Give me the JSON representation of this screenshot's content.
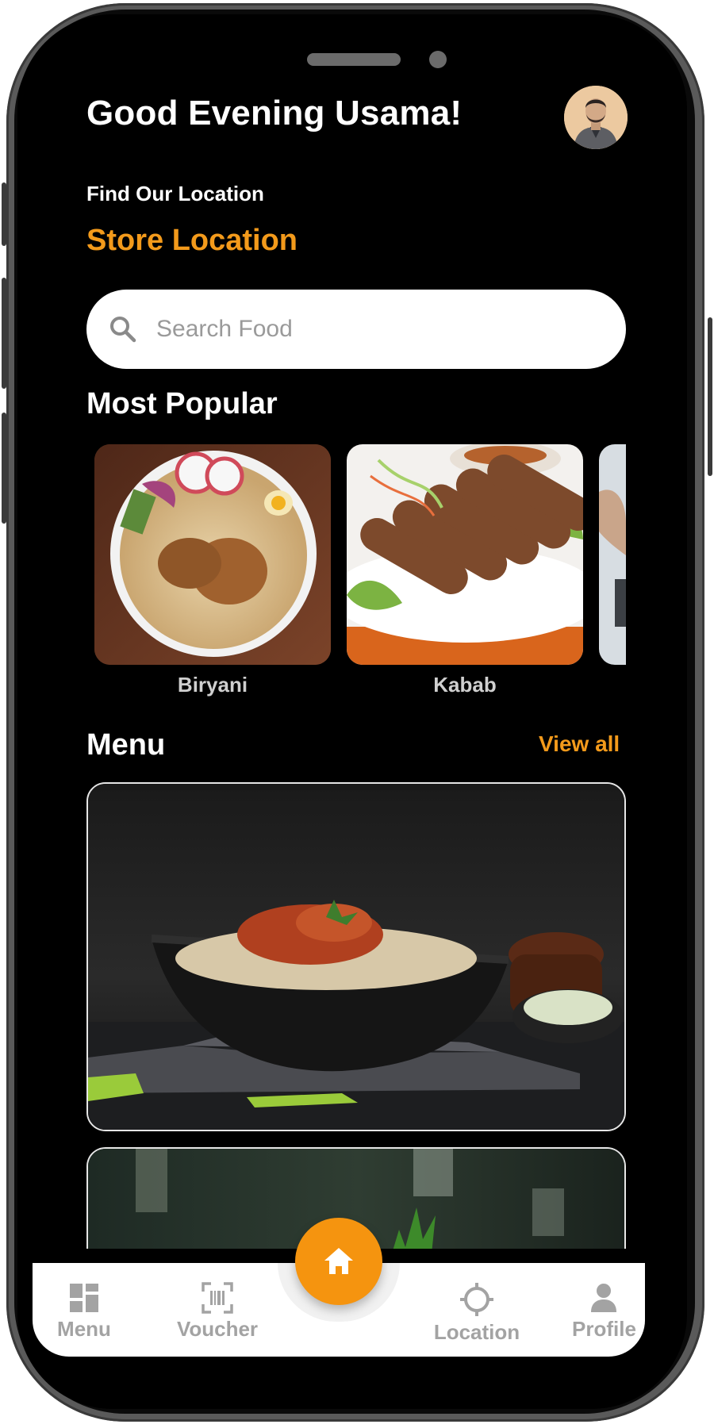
{
  "header": {
    "greeting": "Good Evening Usama!",
    "find_location": "Find Our Location",
    "store_location": "Store Location"
  },
  "search": {
    "placeholder": "Search Food"
  },
  "popular": {
    "title": "Most Popular",
    "items": [
      {
        "label": "Biryani"
      },
      {
        "label": "Kabab"
      }
    ]
  },
  "menu": {
    "title": "Menu",
    "view_all": "View all"
  },
  "bottom_nav": {
    "items": [
      {
        "label": "Menu",
        "icon": "grid-icon"
      },
      {
        "label": "Voucher",
        "icon": "barcode-scan-icon"
      },
      {
        "label": "Location",
        "icon": "crosshair-icon"
      },
      {
        "label": "Profile",
        "icon": "person-icon"
      }
    ],
    "center": {
      "icon": "home-icon"
    }
  },
  "colors": {
    "accent": "#f39a1b",
    "fab": "#f5940f",
    "background": "#000000",
    "nav_text": "#a3a3a3"
  }
}
